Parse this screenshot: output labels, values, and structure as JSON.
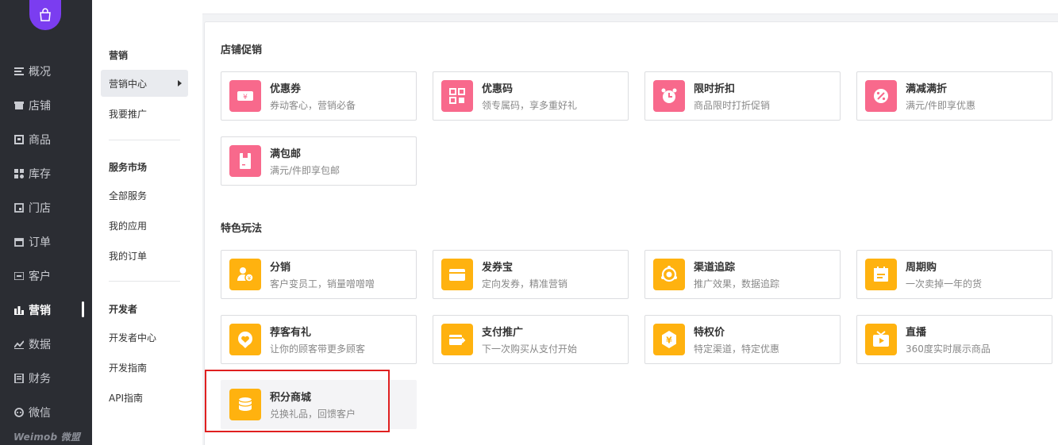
{
  "brand": {
    "text": "Weimob 微盟"
  },
  "nav": {
    "items": [
      {
        "label": "概况",
        "icon": "list-icon"
      },
      {
        "label": "店铺",
        "icon": "store-icon"
      },
      {
        "label": "商品",
        "icon": "product-icon"
      },
      {
        "label": "库存",
        "icon": "inventory-icon"
      },
      {
        "label": "门店",
        "icon": "shop-icon"
      },
      {
        "label": "订单",
        "icon": "order-icon"
      },
      {
        "label": "客户",
        "icon": "customer-icon"
      },
      {
        "label": "营销",
        "icon": "bar-chart-icon",
        "active": true
      },
      {
        "label": "数据",
        "icon": "line-chart-icon"
      },
      {
        "label": "财务",
        "icon": "finance-icon"
      },
      {
        "label": "微信",
        "icon": "wechat-icon"
      }
    ]
  },
  "subnav": {
    "groups": [
      {
        "title": "营销",
        "items": [
          "营销中心",
          "我要推广"
        ]
      },
      {
        "title": "服务市场",
        "items": [
          "全部服务",
          "我的应用",
          "我的订单"
        ]
      },
      {
        "title": "开发者",
        "items": [
          "开发者中心",
          "开发指南",
          "API指南"
        ]
      }
    ]
  },
  "sections": [
    {
      "title": "店铺促销",
      "cards": [
        {
          "title": "优惠券",
          "desc": "券动客心，营销必备",
          "icon": "coupon-icon",
          "color": "#f8698c"
        },
        {
          "title": "优惠码",
          "desc": "领专属码，享多重好礼",
          "icon": "qr-code-icon",
          "color": "#f8698c"
        },
        {
          "title": "限时折扣",
          "desc": "商品限时打折促销",
          "icon": "alarm-clock-icon",
          "color": "#f8698c"
        },
        {
          "title": "满减满折",
          "desc": "满元/件即享优惠",
          "icon": "percent-icon",
          "color": "#f8698c"
        },
        {
          "title": "满包邮",
          "desc": "满元/件即享包邮",
          "icon": "shipping-icon",
          "color": "#f8698c"
        }
      ]
    },
    {
      "title": "特色玩法",
      "cards": [
        {
          "title": "分销",
          "desc": "客户变员工，销量噌噌噌",
          "icon": "distribution-icon",
          "color": "#ffb20f"
        },
        {
          "title": "发券宝",
          "desc": "定向发券，精准营销",
          "icon": "coupon-wallet-icon",
          "color": "#ffb20f"
        },
        {
          "title": "渠道追踪",
          "desc": "推广效果，数据追踪",
          "icon": "channel-track-icon",
          "color": "#ffb20f"
        },
        {
          "title": "周期购",
          "desc": "一次卖掉一年的货",
          "icon": "calendar-icon",
          "color": "#ffb20f"
        },
        {
          "title": "荐客有礼",
          "desc": "让你的顾客带更多顾客",
          "icon": "heart-badge-icon",
          "color": "#ffb20f"
        },
        {
          "title": "支付推广",
          "desc": "下一次购买从支付开始",
          "icon": "payment-icon",
          "color": "#ffb20f"
        },
        {
          "title": "特权价",
          "desc": "特定渠道，特定优惠",
          "icon": "yuan-hexagon-icon",
          "color": "#ffb20f"
        },
        {
          "title": "直播",
          "desc": "360度实时展示商品",
          "icon": "live-tv-icon",
          "color": "#ffb20f"
        },
        {
          "title": "积分商城",
          "desc": "兑换礼品，回馈客户",
          "icon": "coins-icon",
          "color": "#ffb20f",
          "selected": true
        }
      ]
    }
  ]
}
